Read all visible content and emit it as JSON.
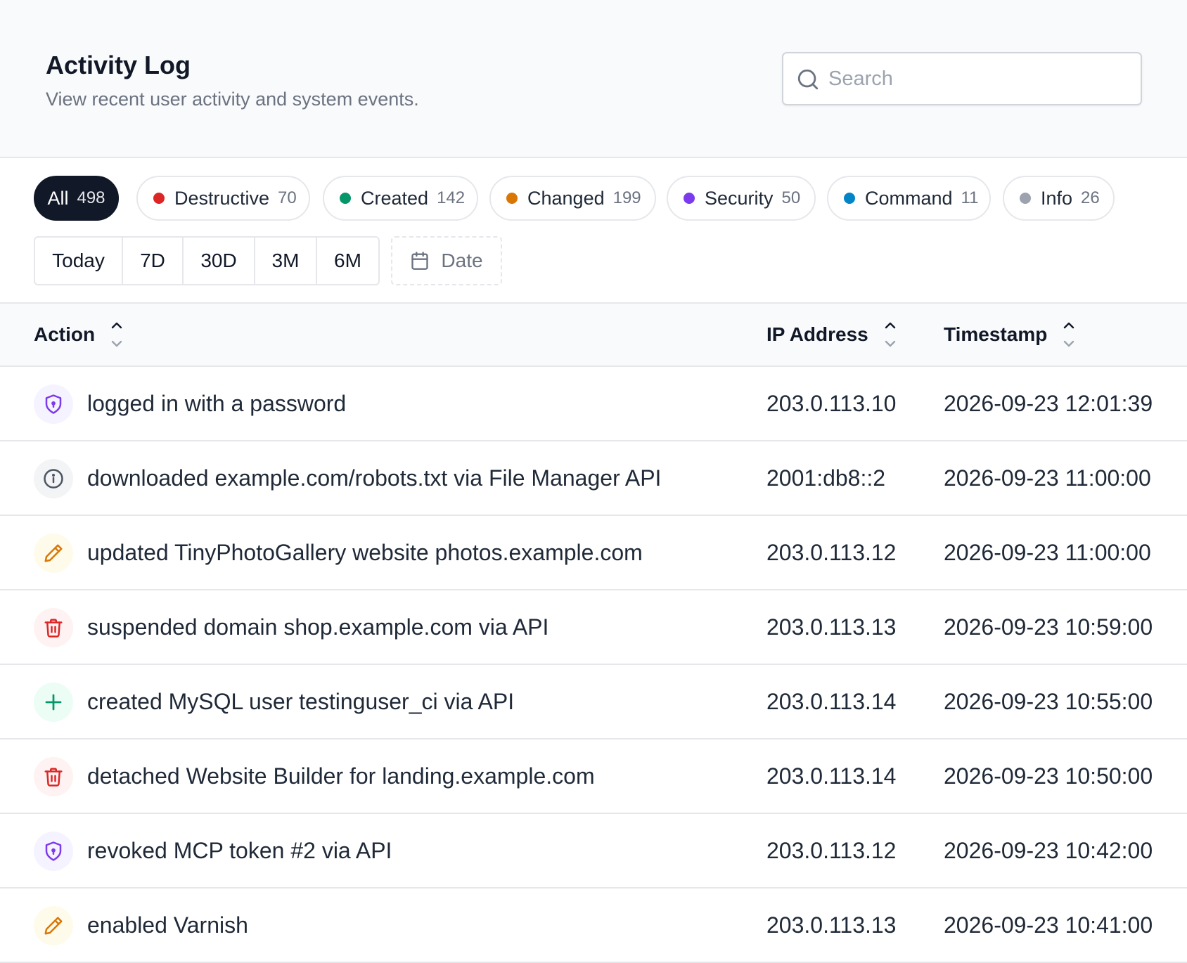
{
  "header": {
    "title": "Activity Log",
    "subtitle": "View recent user activity and system events."
  },
  "search": {
    "placeholder": "Search",
    "value": "",
    "icon": "search-icon"
  },
  "filters": [
    {
      "label": "All",
      "count": "498",
      "active": true,
      "color": ""
    },
    {
      "label": "Destructive",
      "count": "70",
      "active": false,
      "color": "#dc2626"
    },
    {
      "label": "Created",
      "count": "142",
      "active": false,
      "color": "#059669"
    },
    {
      "label": "Changed",
      "count": "199",
      "active": false,
      "color": "#d97706"
    },
    {
      "label": "Security",
      "count": "50",
      "active": false,
      "color": "#7c3aed"
    },
    {
      "label": "Command",
      "count": "11",
      "active": false,
      "color": "#0284c7"
    },
    {
      "label": "Info",
      "count": "26",
      "active": false,
      "color": "#9ca3af"
    }
  ],
  "ranges": [
    "Today",
    "7D",
    "30D",
    "3M",
    "6M"
  ],
  "date_button": {
    "label": "Date",
    "icon": "calendar-icon"
  },
  "table": {
    "columns": {
      "action": "Action",
      "ip": "IP Address",
      "timestamp": "Timestamp"
    },
    "rows": [
      {
        "type": "security",
        "icon": "shield-icon",
        "action": "logged in with a password",
        "ip": "203.0.113.10",
        "timestamp": "2026-09-23 12:01:39"
      },
      {
        "type": "info",
        "icon": "info-icon",
        "action": "downloaded example.com/robots.txt via File Manager API",
        "ip": "2001:db8::2",
        "timestamp": "2026-09-23 11:00:00"
      },
      {
        "type": "changed",
        "icon": "pencil-icon",
        "action": "updated TinyPhotoGallery website photos.example.com",
        "ip": "203.0.113.12",
        "timestamp": "2026-09-23 11:00:00"
      },
      {
        "type": "destructive",
        "icon": "trash-icon",
        "action": "suspended domain shop.example.com via API",
        "ip": "203.0.113.13",
        "timestamp": "2026-09-23 10:59:00"
      },
      {
        "type": "created",
        "icon": "plus-icon",
        "action": "created MySQL user testinguser_ci via API",
        "ip": "203.0.113.14",
        "timestamp": "2026-09-23 10:55:00"
      },
      {
        "type": "destructive",
        "icon": "trash-icon",
        "action": "detached Website Builder for landing.example.com",
        "ip": "203.0.113.14",
        "timestamp": "2026-09-23 10:50:00"
      },
      {
        "type": "security",
        "icon": "shield-icon",
        "action": "revoked MCP token #2 via API",
        "ip": "203.0.113.12",
        "timestamp": "2026-09-23 10:42:00"
      },
      {
        "type": "changed",
        "icon": "pencil-icon",
        "action": "enabled Varnish",
        "ip": "203.0.113.13",
        "timestamp": "2026-09-23 10:41:00"
      }
    ]
  },
  "type_styles": {
    "security": {
      "bg": "#f5f3ff",
      "fg": "#7c3aed"
    },
    "info": {
      "bg": "#f3f4f6",
      "fg": "#4b5563"
    },
    "changed": {
      "bg": "#fffbeb",
      "fg": "#d97706"
    },
    "destructive": {
      "bg": "#fef2f2",
      "fg": "#dc2626"
    },
    "created": {
      "bg": "#ecfdf5",
      "fg": "#059669"
    }
  }
}
